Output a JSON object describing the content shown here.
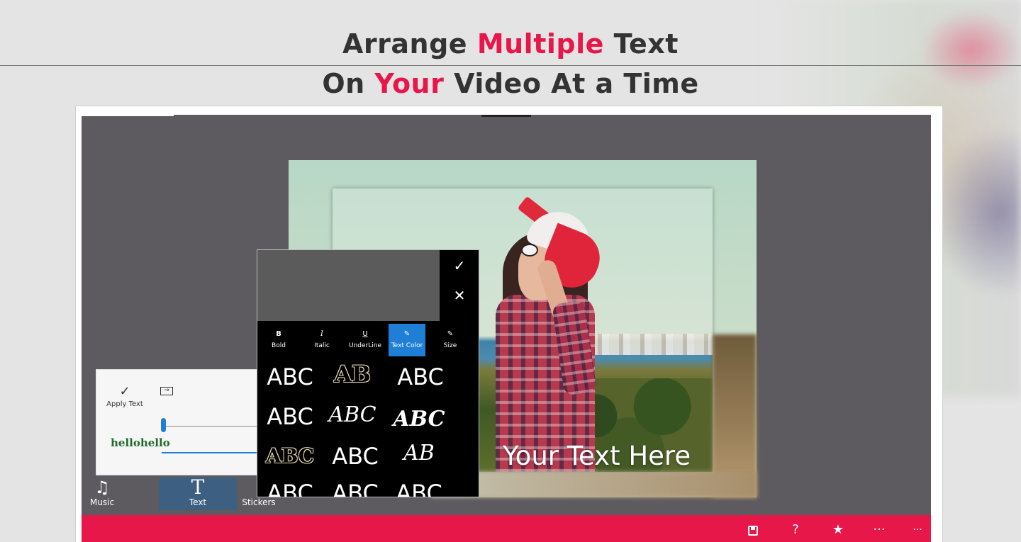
{
  "headline": {
    "line1_pre": "Arrange ",
    "line1_accent": "Multiple",
    "line1_post": " Text",
    "line2_pre": "On ",
    "line2_accent": "Your",
    "line2_post": " Video At a Time",
    "accent_color": "#e8174a"
  },
  "preview": {
    "overlay_text": "Your Text Here"
  },
  "editor": {
    "confirm_icon": "checkmark-icon",
    "cancel_icon": "close-icon",
    "tabs": [
      {
        "glyph": "B",
        "label": "Bold",
        "active": false
      },
      {
        "glyph": "I",
        "label": "Italic",
        "active": false
      },
      {
        "glyph": "U",
        "label": "UnderLine",
        "active": false
      },
      {
        "glyph": "✎",
        "label": "Text Color",
        "active": true
      },
      {
        "glyph": "✎",
        "label": "Size",
        "active": false
      }
    ],
    "font_samples": [
      {
        "text": "ABC"
      },
      {
        "text": "AB"
      },
      {
        "text": "ABC"
      },
      {
        "text": "ABC"
      },
      {
        "text": "ABC"
      },
      {
        "text": "ABC"
      },
      {
        "text": "ABC"
      },
      {
        "text": "ABC"
      },
      {
        "text": "AB"
      },
      {
        "text": "ABC"
      },
      {
        "text": "ABC"
      },
      {
        "text": "ABC"
      }
    ],
    "active_color": "#1f7ed6"
  },
  "tool_card": {
    "apply_label": "Apply Text",
    "sample_text": "hellohello"
  },
  "bottom_tabs": {
    "music": {
      "label": "Music",
      "icon": "music-note-icon"
    },
    "text": {
      "label": "Text",
      "icon": "text-icon"
    },
    "stickers": {
      "label": "Stickers"
    }
  },
  "app_bar": {
    "color": "#e8174a",
    "icons": [
      "save-icon",
      "help-icon",
      "star-icon",
      "more-icon",
      "more-icon"
    ],
    "help_glyph": "?",
    "star_glyph": "★",
    "more_glyph": "···"
  }
}
